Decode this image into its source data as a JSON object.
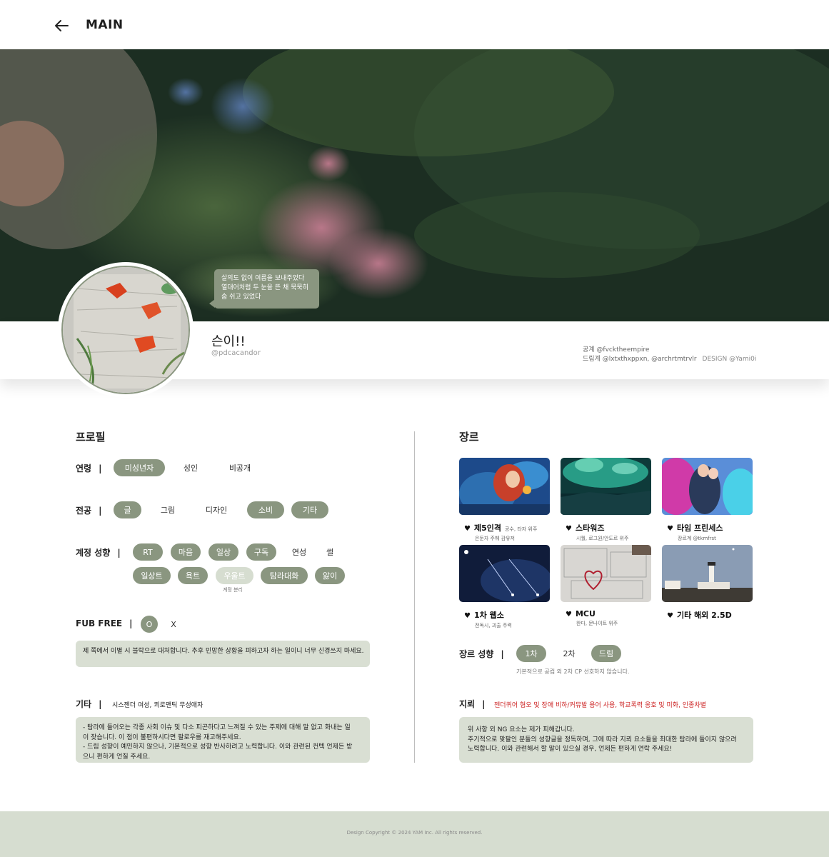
{
  "header": {
    "title": "MAIN"
  },
  "bubble": {
    "lines": [
      "살의도 없이 여름을 보내주었다",
      "열대어처럼 두 눈을 뜬 채 묵묵히",
      "숨 쉬고 있었다"
    ]
  },
  "profile": {
    "name": "슨이!!",
    "handle": "@pdcacandor",
    "public_account": "공계 @fvcktheempire",
    "dream_account": "드림계 @lxtxthxppxn, @archrtmtrvlr",
    "design_credit": "DESIGN @Yami0i"
  },
  "left": {
    "title": "프로필",
    "age": {
      "label": "연령",
      "sep": "|",
      "options": [
        "미성년자",
        "성인",
        "비공개"
      ]
    },
    "major": {
      "label": "전공",
      "sep": "|",
      "options": [
        "글",
        "그림",
        "디자인",
        "소비",
        "기타"
      ]
    },
    "tendency": {
      "label": "계정 성향",
      "sep": "|",
      "row1": [
        "RT",
        "마음",
        "일상",
        "구독",
        "연성",
        "썰"
      ],
      "row2": [
        "일상트",
        "욕트",
        "우울트",
        "탐라대화",
        "앓이"
      ],
      "note": "계정 분리"
    },
    "fub": {
      "label": "FUB FREE",
      "sep": "|",
      "options": [
        "O",
        "X"
      ]
    },
    "fub_note": "제 쪽에서 이별 시 블락으로 대처합니다. 추후 민망한 상황을 피하고자 하는 일이니 너무 신경쓰지 마세요.",
    "etc": {
      "label": "기타",
      "sep": "|",
      "value": "시스젠더 여성,  쾨로맨틱 무성애자"
    },
    "etc_note": [
      "- 탐라에 들어오는 각종 사회 이슈 및 다소 피곤하다고 느껴질 수 있는 주제에 대해 말 없고 화내는 일",
      "이 잦습니다. 이 점이 불편하시다면 팔로우를 재고해주세요.",
      "- 드림 성향이 예민하지 않으나, 기본적으로 성향 반사하려고 노력합니다. 이와 관련된 컨텍 언제든 받",
      "으니 편하게 언질 주세요."
    ]
  },
  "right": {
    "title": "장르",
    "genres": [
      {
        "name": "제5인격",
        "sub": "공수, 타자 위주",
        "desc": "은둔자 주췌 감유저"
      },
      {
        "name": "스타워즈",
        "sub": "",
        "desc": "시퀄, 로그원/안도르 위주"
      },
      {
        "name": "타임 프린세스",
        "sub": "",
        "desc": "장르계 @tkmfrst"
      },
      {
        "name": "1차 웹소",
        "sub": "",
        "desc": "전독시, 괴출 주력"
      },
      {
        "name": "MCU",
        "sub": "",
        "desc": "완다, 문나이트 위주"
      },
      {
        "name": "기타 해외 2.5D",
        "sub": "",
        "desc": ""
      }
    ],
    "genre_pref": {
      "label": "장르 성향",
      "sep": "|",
      "options": [
        "1차",
        "2차",
        "드림"
      ],
      "note": "기본적으로 공컴 외 2차 CP 선호하지 않습니다."
    },
    "mine": {
      "label": "지뢰",
      "sep": "|",
      "value": "젠더퀴어 혐오 및 장애 비하/커뮤발 용어 사용, 학교폭력 옹호 및 미화, 인종차별"
    },
    "mine_note": [
      "위 사항 외 NG 요소는 제가 피해갑니다.",
      "주기적으로 맞팔인 분들의 성향글을 정독하며, 그에 따라 지뢰 요소들을 최대한 탐라에 들이지 않으려",
      "노력합니다. 이와 관련해서 할 말이 있으실 경우, 언제든 편하게 연락 주세요!"
    ]
  },
  "footer": {
    "text": "Design Copyright © 2024 YAM Inc. All rights reserved."
  },
  "colors": {
    "accent": "#8a9680",
    "accent_light": "#d6ddd0",
    "note_bg": "#d9dfd3",
    "warning": "#cc2222"
  },
  "icons": {
    "back": "arrow-left-icon",
    "heart": "heart-icon"
  }
}
